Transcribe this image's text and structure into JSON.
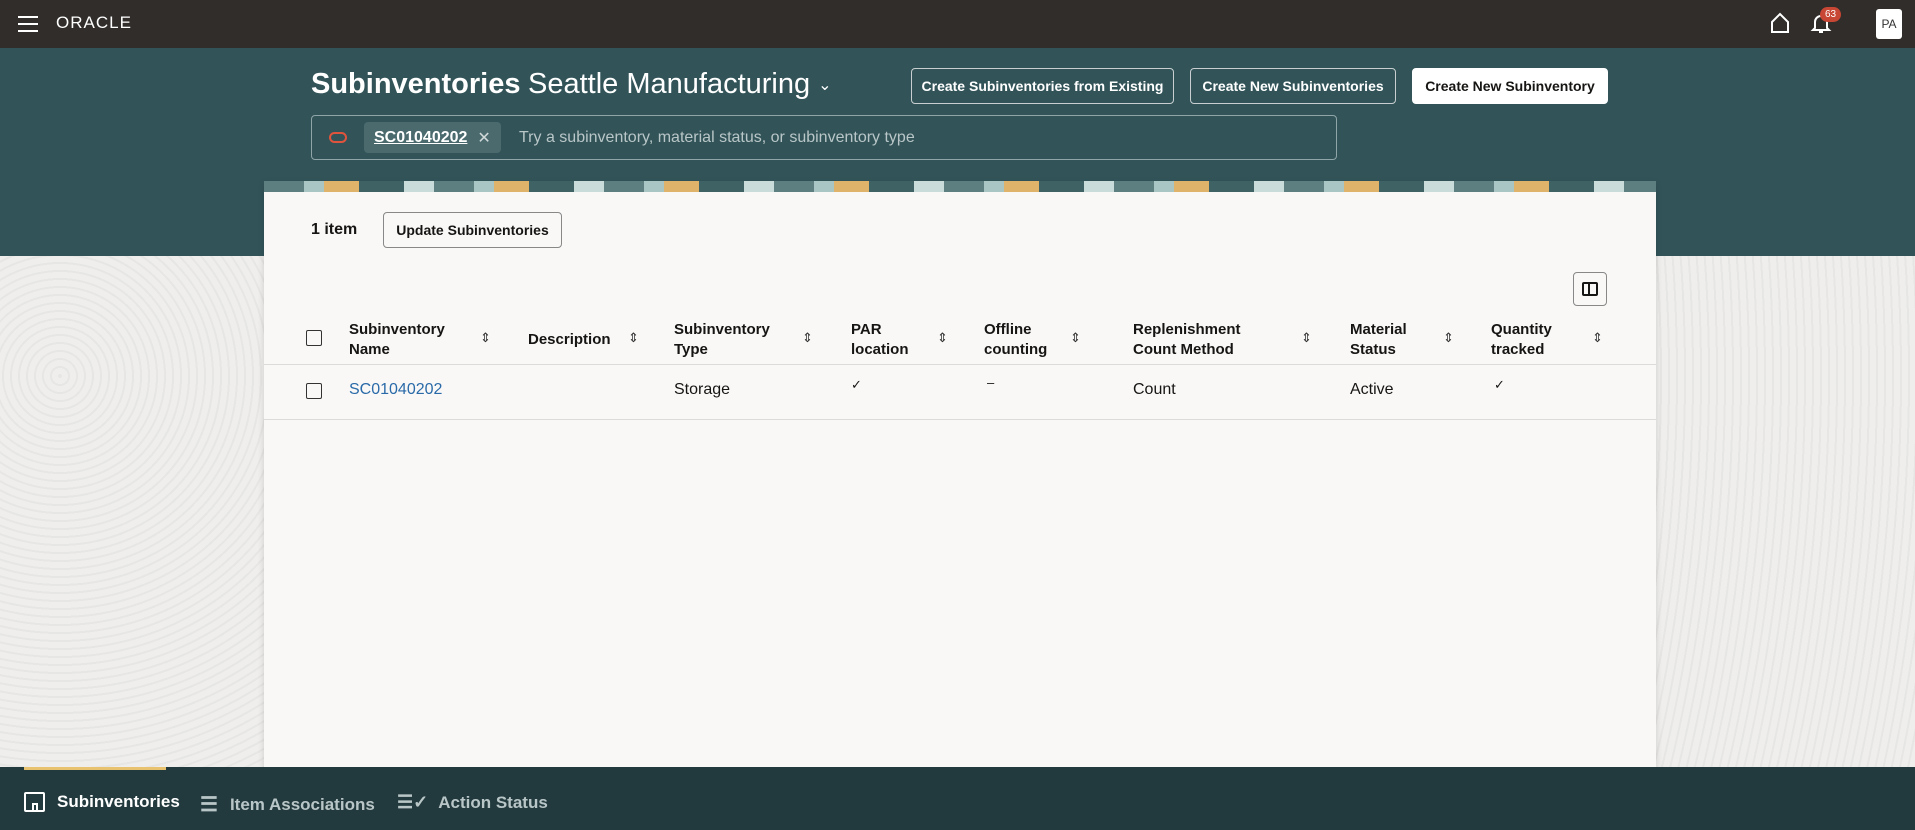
{
  "topbar": {
    "brand": "ORACLE",
    "notification_count": "63",
    "avatar": "PA"
  },
  "header": {
    "title": "Subinventories",
    "org": "Seattle Manufacturing",
    "buttons": {
      "from_existing": "Create Subinventories from Existing",
      "create_new_plural": "Create New Subinventories",
      "create_new": "Create New Subinventory"
    }
  },
  "search": {
    "chip": "SC01040202",
    "placeholder": "Try a subinventory, material status, or subinventory type"
  },
  "toolbar": {
    "count": "1 item",
    "update": "Update Subinventories"
  },
  "table": {
    "columns": [
      {
        "l1": "Subinventory",
        "l2": "Name"
      },
      {
        "l1": "Description",
        "l2": ""
      },
      {
        "l1": "Subinventory",
        "l2": "Type"
      },
      {
        "l1": "PAR",
        "l2": "location"
      },
      {
        "l1": "Offline",
        "l2": "counting"
      },
      {
        "l1": "Replenishment",
        "l2": "Count Method"
      },
      {
        "l1": "Material",
        "l2": "Status"
      },
      {
        "l1": "Quantity",
        "l2": "tracked"
      }
    ],
    "rows": [
      {
        "name": "SC01040202",
        "description": "",
        "type": "Storage",
        "par": "✓",
        "offline": "–",
        "method": "Count",
        "status": "Active",
        "qty": "✓"
      }
    ]
  },
  "nav": {
    "tabs": [
      "Subinventories",
      "Item Associations",
      "Action Status"
    ]
  },
  "colors": {
    "accent": "#e8c26f",
    "link": "#2a6aa8",
    "badge": "#c74634"
  }
}
